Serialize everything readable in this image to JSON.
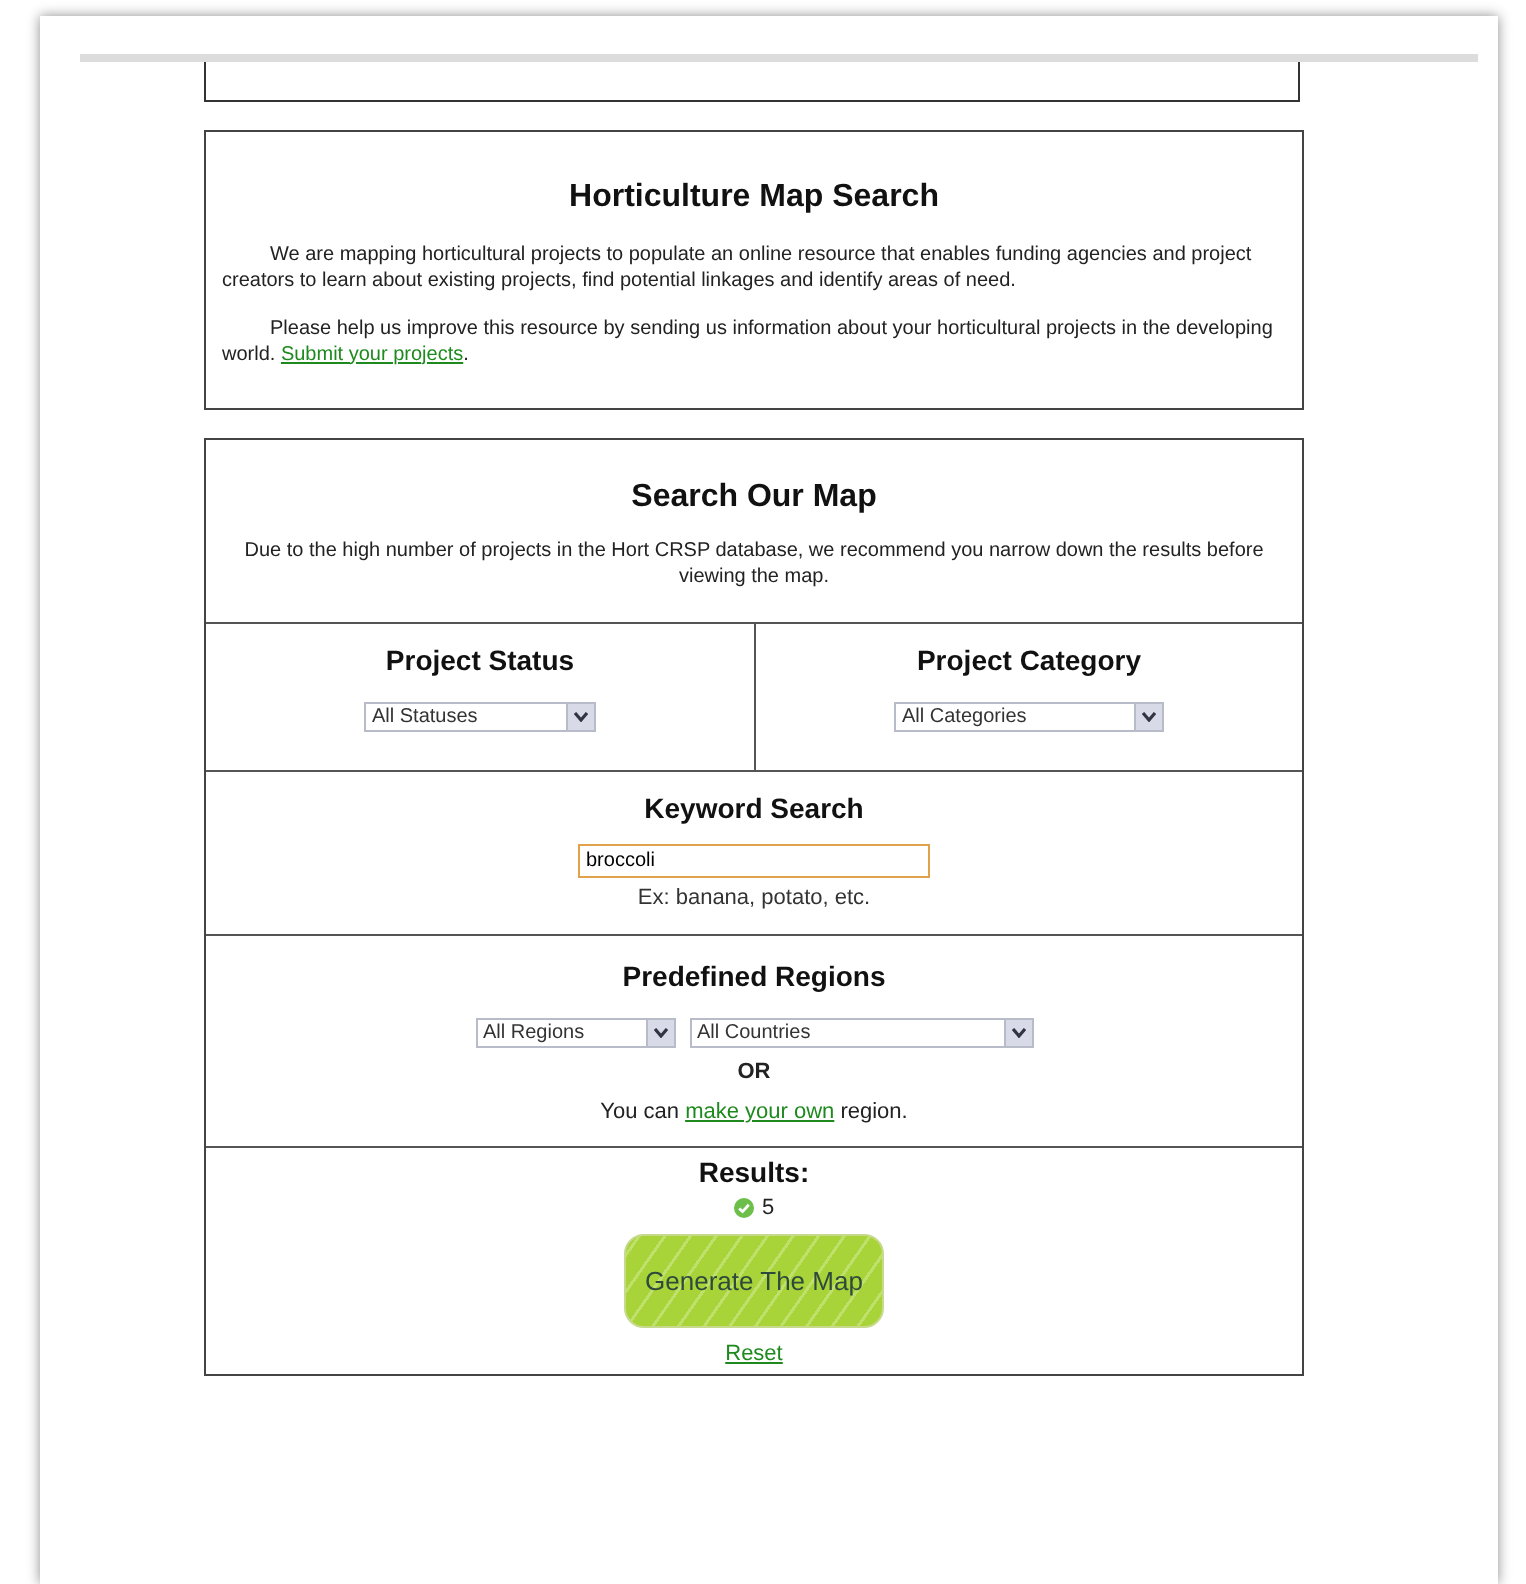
{
  "intro": {
    "title": "Horticulture Map Search",
    "paragraph_1": "We are mapping horticultural projects to populate an online resource that enables funding agencies and project creators to learn about existing projects, find potential linkages and identify areas of need.",
    "paragraph_2": {
      "text": "Please help us improve this resource by sending us information about your horticultural projects in the developing world. ",
      "link": "Submit your projects",
      "after": "."
    }
  },
  "search": {
    "title": "Search Our Map",
    "description": "Due to the high number of projects in the Hort CRSP database, we recommend you narrow down the results before viewing the map.",
    "status": {
      "label": "Project Status",
      "value": "All Statuses"
    },
    "category": {
      "label": "Project Category",
      "value": "All Categories"
    },
    "keyword": {
      "label": "Keyword Search",
      "value": "broccoli",
      "hint": "Ex: banana, potato, etc."
    },
    "regions": {
      "label": "Predefined Regions",
      "region": "All Regions",
      "country": "All Countries",
      "or": "OR",
      "own": {
        "before": "You can ",
        "link": "make your own",
        "after": " region."
      }
    },
    "results": {
      "label": "Results:",
      "count": "5",
      "button": "Generate The Map",
      "reset": "Reset"
    }
  }
}
